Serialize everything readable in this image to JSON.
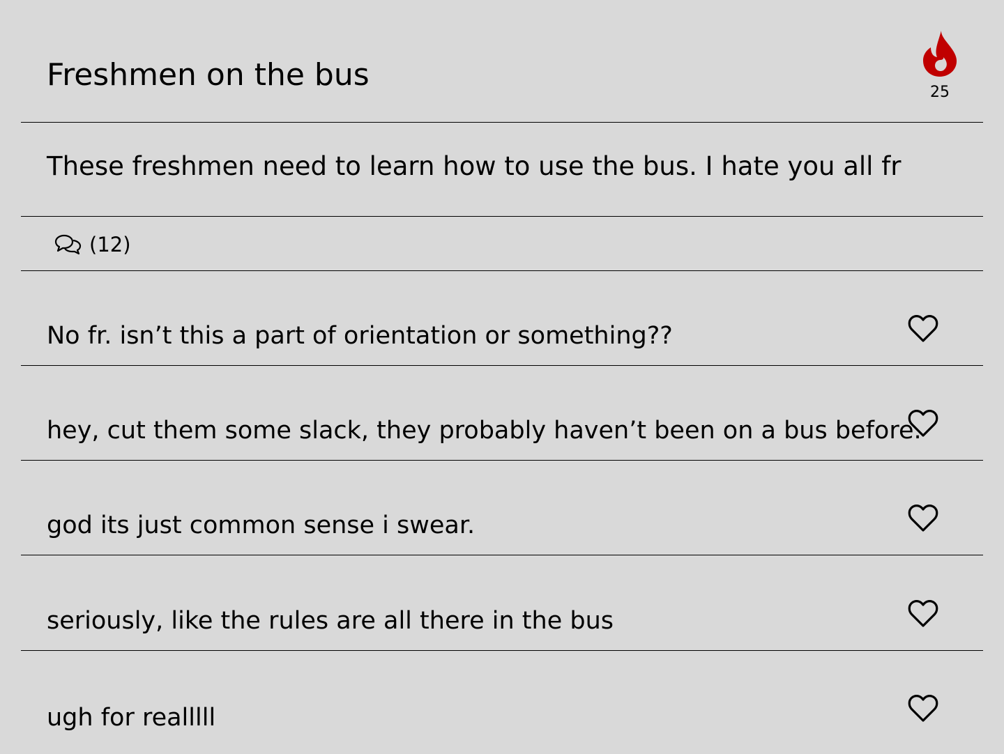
{
  "post": {
    "title": "Freshmen on the bus",
    "heat_count": "25",
    "heat_icon": "flame-icon",
    "body": "These freshmen need to learn how to use the bus. I hate you all fr"
  },
  "comments_bar": {
    "icon": "comments-icon",
    "count_label": "(12)"
  },
  "comments": [
    {
      "text": "No fr. isn’t this a part of orientation or something??"
    },
    {
      "text": "hey, cut them some slack, they probably haven’t been on a bus before."
    },
    {
      "text": "god its just common sense i swear."
    },
    {
      "text": "seriously, like the rules are all there in the bus"
    },
    {
      "text": "ugh for realllll"
    }
  ],
  "colors": {
    "background": "#d9d9d9",
    "flame": "#c00000",
    "text": "#000000"
  }
}
